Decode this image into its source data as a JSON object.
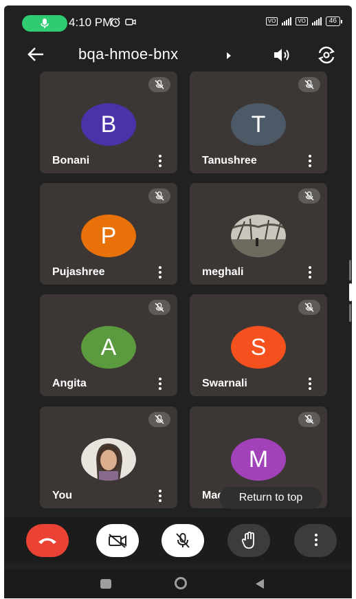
{
  "status_bar": {
    "time": "4:10 PM",
    "battery": "46"
  },
  "meeting": {
    "code": "bqa-hmoe-bnx"
  },
  "participants": [
    {
      "name": "Bonani",
      "initial": "B",
      "color": "#4a32a8",
      "photo": false,
      "muted": true
    },
    {
      "name": "Tanushree",
      "initial": "T",
      "color": "#4b5a66",
      "photo": false,
      "muted": true
    },
    {
      "name": "Pujashree",
      "initial": "P",
      "color": "#e8710a",
      "photo": false,
      "muted": true
    },
    {
      "name": "meghali",
      "initial": "",
      "color": "",
      "photo": true,
      "muted": true
    },
    {
      "name": "Angita",
      "initial": "A",
      "color": "#5b9a3e",
      "photo": false,
      "muted": true
    },
    {
      "name": "Swarnali",
      "initial": "S",
      "color": "#f4511e",
      "photo": false,
      "muted": true
    },
    {
      "name": "You",
      "initial": "",
      "color": "",
      "photo": true,
      "muted": true
    },
    {
      "name": "Mad",
      "initial": "M",
      "color": "#a142b8",
      "photo": false,
      "muted": true
    }
  ],
  "toast": {
    "text": "Return to top"
  },
  "icons": {
    "back": "arrow-left-icon",
    "speaker": "speaker-icon",
    "flip_camera": "flip-camera-icon",
    "mic_muted": "mic-off-icon",
    "more": "more-vertical-icon",
    "end_call": "phone-end-icon",
    "camera_off": "camera-off-icon",
    "raise_hand": "hand-icon",
    "home": "circle-home-icon",
    "recents": "square-recents-icon",
    "back_nav": "triangle-back-icon"
  },
  "colors": {
    "end_call": "#ea4335",
    "toggle_active": "#ffffff",
    "control_dark": "#3c3c3c",
    "tile_bg": "#3c3734"
  }
}
